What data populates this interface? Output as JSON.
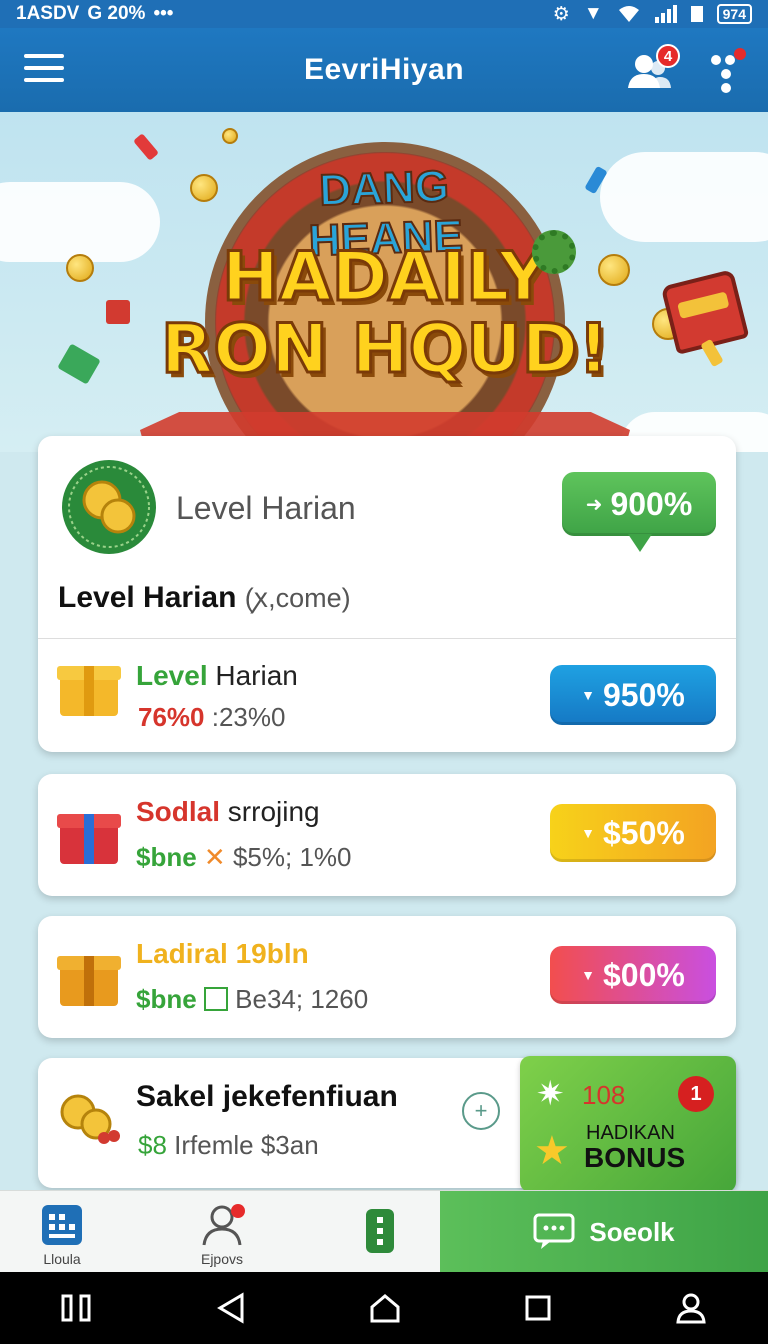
{
  "status_bar": {
    "left_text": "1ASDV",
    "signal_text": "G 20%",
    "dots": "•••",
    "battery": "974"
  },
  "app_bar": {
    "title": "EevriHiyan",
    "notification_count": "4"
  },
  "hero": {
    "arc_text": "DANG HEANE",
    "title_line1": "HADAILY",
    "title_line2": "RON HQUD!"
  },
  "main_card": {
    "heading": "Level Harian",
    "pill_label": "900%",
    "pill_arrow": "➜",
    "subtitle": "Level Harian",
    "subtitle_extra": "(ꭗ,come)",
    "row": {
      "title_green": "Level",
      "title_dark": "Harian",
      "sub_red": "76%0",
      "sub_gray": ":23%0",
      "pill_label": "950%"
    }
  },
  "items": [
    {
      "title_red": "Sodlal",
      "title_dark": "srrojing",
      "sub_green": "$bne",
      "sub_gray": "$5%; 1%0",
      "pill_label": "$50%",
      "colors": {
        "pill_from": "#f7d21a",
        "pill_to": "#f3a322"
      }
    },
    {
      "title_orange": "Ladiral 19bln",
      "sub_green": "$bne",
      "sub_gray": "Be34; 1260",
      "pill_label": "$00%",
      "colors": {
        "pill_from": "#f24e4e",
        "pill_to": "#c94fe0"
      }
    }
  ],
  "last_item": {
    "title": "Sakel jekefenfiuan",
    "sub_green": "$8",
    "sub_gray": "Irfemle $3an",
    "bonus_count": "108",
    "bonus_badge": "1",
    "bonus_line1": "HADIKAN",
    "bonus_line2": "BONUS"
  },
  "tabs": {
    "home_label": "Lloula",
    "profile_label": "Ejpovs",
    "social_label": "Soeolk"
  },
  "colors": {
    "primary": "#1f78c1",
    "green": "#36a43a",
    "blue_pill": "#1a8fd6"
  }
}
